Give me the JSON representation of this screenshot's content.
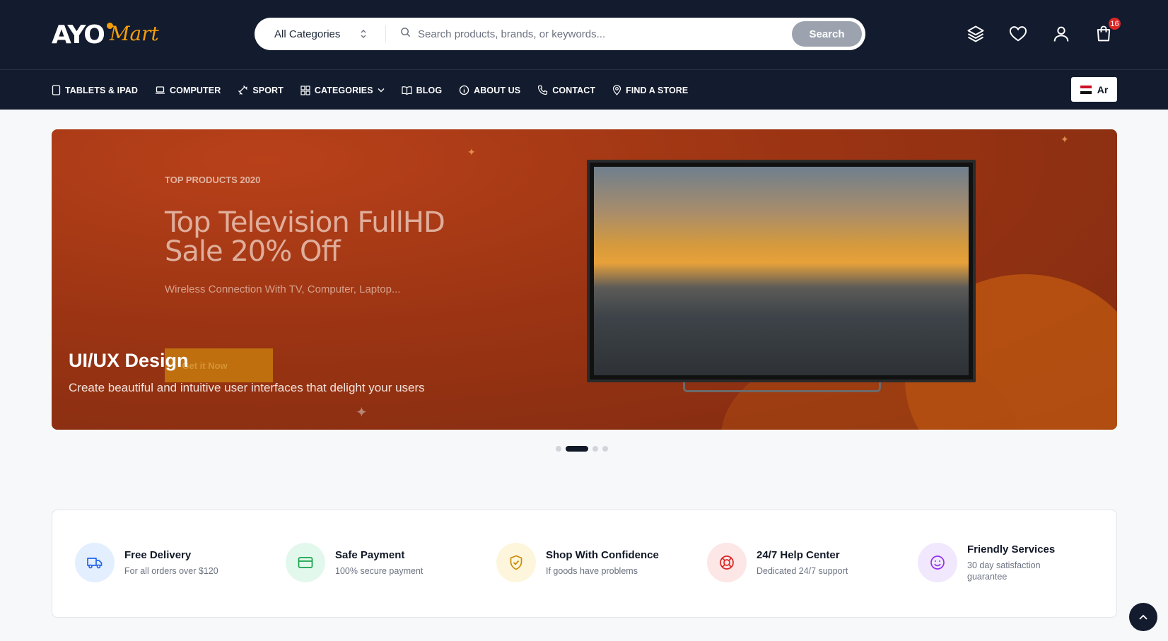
{
  "header": {
    "logo_text": "AYO",
    "logo_script": "Mart",
    "category_select": "All Categories",
    "search_placeholder": "Search products, brands, or keywords...",
    "search_button": "Search",
    "cart_count": "16"
  },
  "nav": {
    "items": [
      {
        "label": "TABLETS & IPAD"
      },
      {
        "label": "COMPUTER"
      },
      {
        "label": "SPORT"
      },
      {
        "label": "CATEGORIES"
      },
      {
        "label": "BLOG"
      },
      {
        "label": "ABOUT US"
      },
      {
        "label": "CONTACT"
      },
      {
        "label": "FIND A STORE"
      }
    ],
    "language": "Ar"
  },
  "hero": {
    "eyebrow": "TOP PRODUCTS 2020",
    "title": "Top Television FullHD Sale 20% Off",
    "subtitle": "Wireless Connection With TV, Computer, Laptop...",
    "cta": "Get it Now",
    "overlay_title": "UI/UX Design",
    "overlay_description": "Create beautiful and intuitive user interfaces that delight your users",
    "slides_total": 4,
    "active_slide": 2
  },
  "features": [
    {
      "title": "Free Delivery",
      "desc": "For all orders over $120",
      "icon": "truck-icon",
      "bg": "#e3efff",
      "color": "#2563eb"
    },
    {
      "title": "Safe Payment",
      "desc": "100% secure payment",
      "icon": "credit-card-icon",
      "bg": "#e3f8ec",
      "color": "#16a34a"
    },
    {
      "title": "Shop With Confidence",
      "desc": "If goods have problems",
      "icon": "shield-check-icon",
      "bg": "#fdf6dc",
      "color": "#ca8a04"
    },
    {
      "title": "24/7 Help Center",
      "desc": "Dedicated 24/7 support",
      "icon": "lifebuoy-icon",
      "bg": "#fde6e6",
      "color": "#dc2626"
    },
    {
      "title": "Friendly Services",
      "desc": "30 day satisfaction guarantee",
      "icon": "smile-icon",
      "bg": "#f1e8fd",
      "color": "#9333ea"
    }
  ],
  "colors": {
    "header_bg": "#131b2e",
    "accent": "#f59e0b",
    "hero_bg": "#9b3413"
  }
}
